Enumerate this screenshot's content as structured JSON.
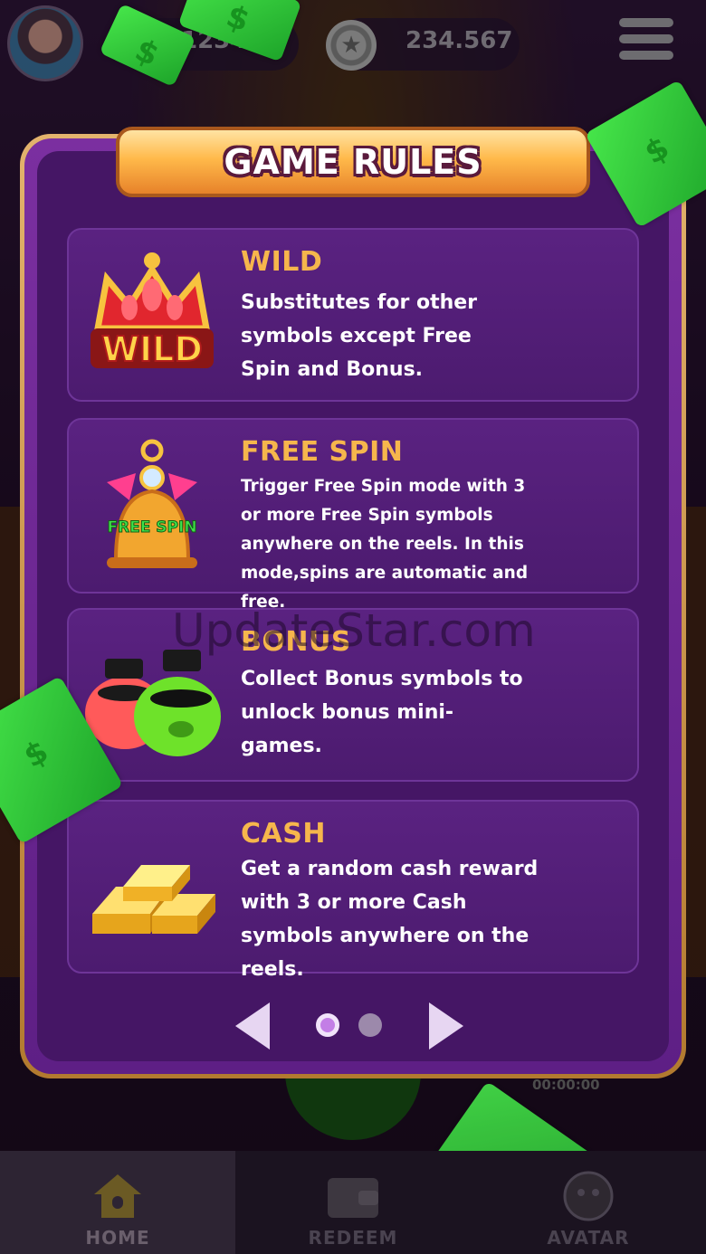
{
  "topbar": {
    "cash_value": "1234.69",
    "coin_value": "234.567"
  },
  "modal": {
    "title": "GAME RULES",
    "close_symbol": "✕"
  },
  "rules": [
    {
      "title": "WILD",
      "icon": "wild-crown-icon",
      "icon_text": "WILD",
      "description": "Substitutes for other symbols except Free Spin and Bonus."
    },
    {
      "title": "FREE SPIN",
      "icon": "free-spin-bell-icon",
      "icon_text": "FREE SPIN",
      "description": "Trigger Free Spin mode with 3 or more Free Spin symbols anywhere on the reels. In this mode,spins are automatic and free."
    },
    {
      "title": "BONUS",
      "icon": "bonus-pigs-icon",
      "description": "Collect Bonus symbols to unlock bonus mini-games."
    },
    {
      "title": "CASH",
      "icon": "gold-bars-icon",
      "description": "Get a random cash reward with 3 or more Cash symbols anywhere on the reels."
    }
  ],
  "pagination": {
    "current_page": 1,
    "total_pages": 2
  },
  "timer": "00:00:00",
  "watermark": "UpdateStar.com",
  "bottom_nav": [
    {
      "label": "HOME",
      "icon": "home-icon",
      "active": true
    },
    {
      "label": "REDEEM",
      "icon": "wallet-icon",
      "active": false
    },
    {
      "label": "AVATAR",
      "icon": "avatar-icon",
      "active": false
    }
  ],
  "colors": {
    "rule_title": "#f6b64c",
    "panel": "#451665",
    "banner": "#ffb94a",
    "bill_green": "#46e64a"
  }
}
